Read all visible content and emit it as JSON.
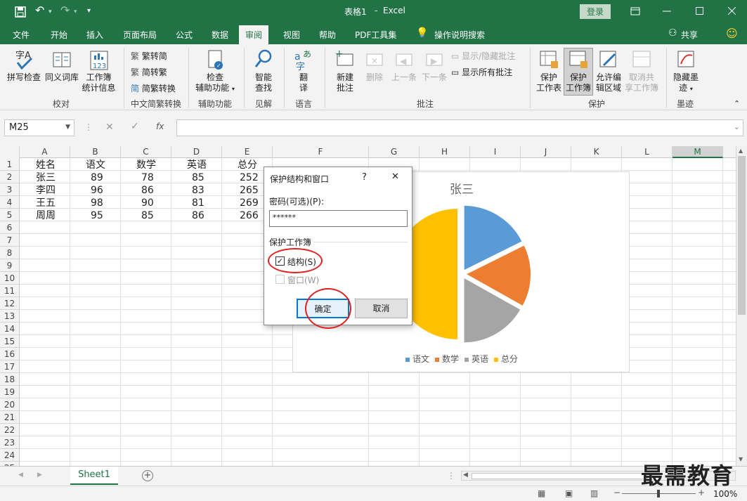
{
  "title": {
    "doc": "表格1",
    "sep": "-",
    "app": "Excel",
    "login": "登录"
  },
  "tabs": [
    "文件",
    "开始",
    "插入",
    "页面布局",
    "公式",
    "数据",
    "审阅",
    "视图",
    "帮助",
    "PDF工具集",
    "操作说明搜索"
  ],
  "share": "共享",
  "ribbon": {
    "spell": "拼写检查",
    "thesaurus": "同义词库",
    "stats1": "工作簿",
    "stats2": "统计信息",
    "g_proof": "校对",
    "t2s": "繁转简",
    "s2t": "简转繁",
    "conv": "简繁转换",
    "g_cn": "中文简繁转换",
    "check1": "检查",
    "check2": "辅助功能",
    "g_access": "辅助功能",
    "smart1": "智能",
    "smart2": "查找",
    "g_insight": "见解",
    "trans1": "翻",
    "trans2": "译",
    "g_lang": "语言",
    "new1": "新建",
    "new2": "批注",
    "del": "删除",
    "prev": "上一条",
    "next": "下一条",
    "showhide": "显示/隐藏批注",
    "showall": "显示所有批注",
    "g_comment": "批注",
    "ps1": "保护",
    "ps2": "工作表",
    "pw1": "保护",
    "pw2": "工作簿",
    "ae1": "允许编",
    "ae2": "辑区域",
    "us1": "取消共",
    "us2": "享工作簿",
    "g_protect": "保护",
    "ink1": "隐藏墨",
    "ink2": "迹",
    "g_ink": "墨迹"
  },
  "formula": {
    "namebox": "M25",
    "fx": "fx"
  },
  "columns": [
    "A",
    "B",
    "C",
    "D",
    "E",
    "F",
    "G",
    "H",
    "I",
    "J",
    "K",
    "L",
    "M"
  ],
  "rows": [
    "1",
    "2",
    "3",
    "4",
    "5",
    "6",
    "7",
    "8",
    "9",
    "10",
    "11",
    "12",
    "13",
    "14",
    "15",
    "16",
    "17",
    "18",
    "19",
    "20",
    "21",
    "22",
    "23",
    "24",
    "25"
  ],
  "table": [
    [
      "姓名",
      "语文",
      "数学",
      "英语",
      "总分"
    ],
    [
      "张三",
      "89",
      "78",
      "85",
      "252"
    ],
    [
      "李四",
      "96",
      "86",
      "83",
      "265"
    ],
    [
      "王五",
      "98",
      "90",
      "81",
      "269"
    ],
    [
      "周周",
      "95",
      "85",
      "86",
      "266"
    ]
  ],
  "chart_data": {
    "type": "pie",
    "title": "张三",
    "categories": [
      "语文",
      "数学",
      "英语",
      "总分"
    ],
    "values": [
      89,
      78,
      85,
      252
    ],
    "colors": [
      "#5b9bd5",
      "#ed7d31",
      "#a5a5a5",
      "#ffc000"
    ],
    "legend": "bottom"
  },
  "dialog": {
    "title": "保护结构和窗口",
    "help": "?",
    "close": "✕",
    "pwd_label": "密码(可选)(P):",
    "pwd_value": "******",
    "section": "保护工作簿",
    "structure": "结构(S)",
    "window": "窗口(W)",
    "ok": "确定",
    "cancel": "取消"
  },
  "sheet": {
    "tab": "Sheet1",
    "add": "+"
  },
  "status": {
    "zoom": "100%"
  },
  "watermark": "最需教育"
}
